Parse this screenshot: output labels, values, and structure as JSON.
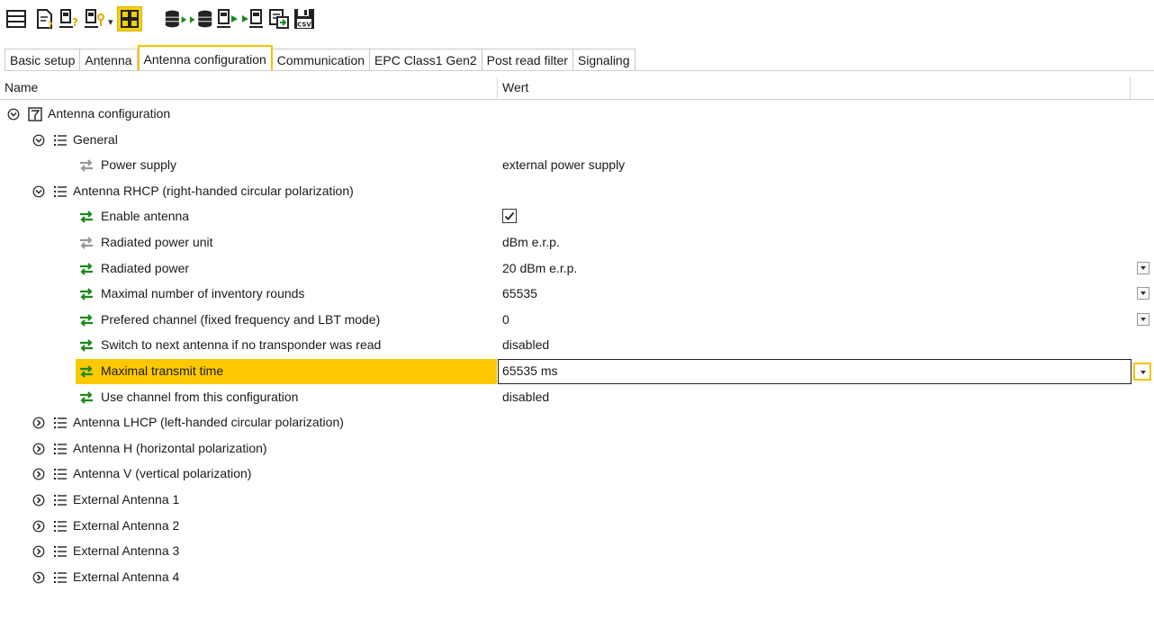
{
  "toolbar": {
    "icons": [
      "list-view-icon",
      "document-question-icon",
      "device-key-question-icon",
      "device-key-icon",
      "grid-view-icon",
      "database-export-icon",
      "database-import-icon",
      "device-export-icon",
      "device-import-icon",
      "settings-compare-icon",
      "save-csv-icon"
    ],
    "dropdown_glyph": "▾",
    "csv_label": "CSV"
  },
  "tabs": [
    {
      "label": "Basic setup",
      "selected": false
    },
    {
      "label": "Antenna",
      "selected": false
    },
    {
      "label": "Antenna configuration",
      "selected": true
    },
    {
      "label": "Communication",
      "selected": false
    },
    {
      "label": "EPC Class1 Gen2",
      "selected": false
    },
    {
      "label": "Post read filter",
      "selected": false
    },
    {
      "label": "Signaling",
      "selected": false
    }
  ],
  "grid": {
    "header": {
      "name": "Name",
      "value": "Wert"
    },
    "rows": [
      {
        "label": "Antenna configuration",
        "level": 0,
        "kind": "root",
        "expanded": true
      },
      {
        "label": "General",
        "level": 1,
        "kind": "group",
        "expanded": true
      },
      {
        "label": "Power supply",
        "level": 2,
        "kind": "readonly",
        "value": "external power supply"
      },
      {
        "label": "Antenna RHCP (right-handed circular polarization)",
        "level": 1,
        "kind": "group",
        "expanded": true
      },
      {
        "label": "Enable antenna",
        "level": 2,
        "kind": "editable",
        "checkbox": true
      },
      {
        "label": "Radiated power unit",
        "level": 2,
        "kind": "readonly",
        "value": "dBm e.r.p."
      },
      {
        "label": "Radiated power",
        "level": 2,
        "kind": "editable",
        "value": "20 dBm e.r.p.",
        "dropdown": true
      },
      {
        "label": "Maximal number of inventory rounds",
        "level": 2,
        "kind": "editable",
        "value": "65535",
        "dropdown": true
      },
      {
        "label": "Prefered channel  (fixed frequency and LBT mode)",
        "level": 2,
        "kind": "editable",
        "value": "0",
        "dropdown": true
      },
      {
        "label": "Switch to next antenna if no transponder was read",
        "level": 2,
        "kind": "editable",
        "value": "disabled"
      },
      {
        "label": "Maximal transmit time",
        "level": 2,
        "kind": "editable",
        "value": "65535 ms",
        "dropdown": true,
        "selected": true
      },
      {
        "label": "Use channel from this configuration",
        "level": 2,
        "kind": "editable",
        "value": "disabled"
      },
      {
        "label": "Antenna LHCP (left-handed circular polarization)",
        "level": 1,
        "kind": "group",
        "expanded": false
      },
      {
        "label": "Antenna H (horizontal polarization)",
        "level": 1,
        "kind": "group",
        "expanded": false
      },
      {
        "label": "Antenna V (vertical polarization)",
        "level": 1,
        "kind": "group",
        "expanded": false
      },
      {
        "label": "External Antenna 1",
        "level": 1,
        "kind": "group",
        "expanded": false
      },
      {
        "label": "External Antenna 2",
        "level": 1,
        "kind": "group",
        "expanded": false
      },
      {
        "label": "External Antenna 3",
        "level": 1,
        "kind": "group",
        "expanded": false
      },
      {
        "label": "External Antenna 4",
        "level": 1,
        "kind": "group",
        "expanded": false
      }
    ]
  },
  "colors": {
    "accent": "#fcc800",
    "editable_icon": "#1a8a1a",
    "readonly_icon": "#9a9a9a"
  }
}
